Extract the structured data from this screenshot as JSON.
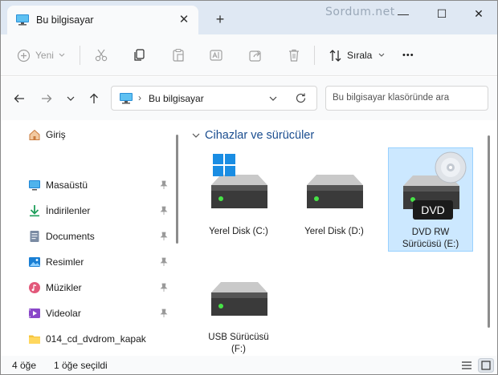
{
  "window": {
    "tab_title": "Bu bilgisayar",
    "watermark": "Sordum.net",
    "close_tab_glyph": "✕",
    "new_tab_glyph": "+",
    "controls": {
      "minimize": "—",
      "maximize": "☐",
      "close": "✕"
    }
  },
  "toolbar": {
    "new_label": "Yeni",
    "sort_label": "Sırala",
    "more_glyph": "•••",
    "icons": [
      "new-icon",
      "cut-icon",
      "copy-icon",
      "paste-icon",
      "rename-icon",
      "share-icon",
      "delete-icon",
      "sort-icon",
      "more-icon"
    ]
  },
  "address": {
    "path": "Bu bilgisayar",
    "separator": "›",
    "search_placeholder": "Bu bilgisayar klasöründe ara"
  },
  "sidebar": {
    "home": "Giriş",
    "items": [
      {
        "label": "Masaüstü",
        "icon": "desktop-icon",
        "pinned": true
      },
      {
        "label": "İndirilenler",
        "icon": "downloads-icon",
        "pinned": true
      },
      {
        "label": "Documents",
        "icon": "documents-icon",
        "pinned": true
      },
      {
        "label": "Resimler",
        "icon": "pictures-icon",
        "pinned": true
      },
      {
        "label": "Müzikler",
        "icon": "music-icon",
        "pinned": true
      },
      {
        "label": "Videolar",
        "icon": "videos-icon",
        "pinned": true
      },
      {
        "label": "014_cd_dvdrom_kapak",
        "icon": "folder-icon",
        "pinned": false
      }
    ]
  },
  "content": {
    "group_title": "Cihazlar ve sürücüler",
    "drives": [
      {
        "label": "Yerel Disk (C:)",
        "icon": "windows-drive-icon",
        "selected": false
      },
      {
        "label": "Yerel Disk (D:)",
        "icon": "drive-icon",
        "selected": false
      },
      {
        "label_line1": "DVD RW",
        "label_line2": "Sürücüsü (E:)",
        "badge": "DVD",
        "icon": "dvd-drive-icon",
        "selected": true
      },
      {
        "label_line1": "USB Sürücüsü",
        "label_line2": "(F:)",
        "icon": "usb-drive-icon",
        "selected": false
      }
    ]
  },
  "status": {
    "item_count": "4 öğe",
    "selected_count": "1 öğe seçildi"
  },
  "colors": {
    "accent": "#0067c0",
    "selection": "#cce8ff",
    "titlebar": "#dfe8f3",
    "group_title": "#1a4d8f"
  }
}
